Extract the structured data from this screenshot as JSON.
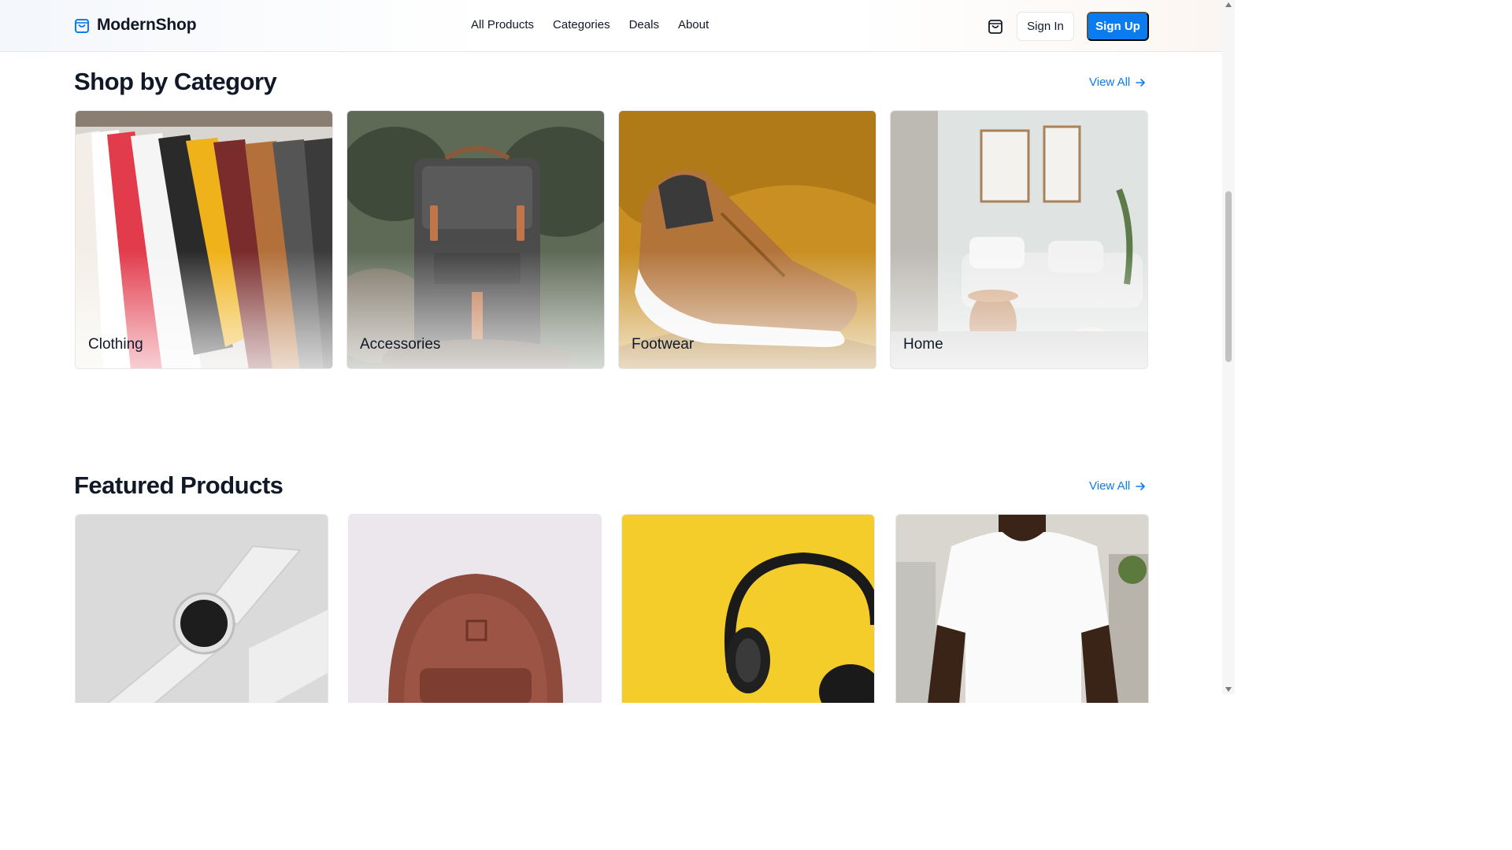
{
  "brand": {
    "name": "ModernShop",
    "accent": "#0b7cf0",
    "logo_icon": "shopping-bag-icon"
  },
  "nav": {
    "items": [
      "All Products",
      "Categories",
      "Deals",
      "About"
    ]
  },
  "header_actions": {
    "cart_icon": "shopping-bag-icon",
    "sign_in": "Sign In",
    "sign_up": "Sign Up"
  },
  "categories_section": {
    "title": "Shop by Category",
    "view_all": "View All",
    "view_all_icon": "arrow-right-icon",
    "items": [
      {
        "label": "Clothing"
      },
      {
        "label": "Accessories"
      },
      {
        "label": "Footwear"
      },
      {
        "label": "Home"
      }
    ]
  },
  "featured_section": {
    "title": "Featured Products",
    "view_all": "View All",
    "view_all_icon": "arrow-right-icon",
    "items": [
      {
        "image": "smartwatch"
      },
      {
        "image": "leather-backpack"
      },
      {
        "image": "headphones"
      },
      {
        "image": "white-tshirt"
      }
    ]
  }
}
